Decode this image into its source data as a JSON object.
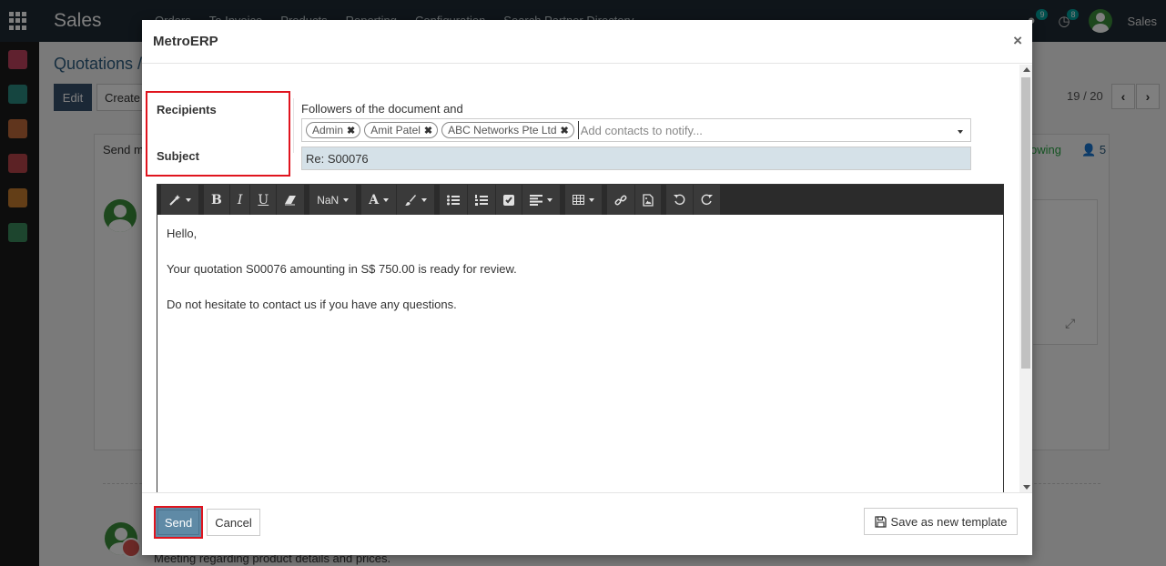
{
  "background": {
    "app_name": "Sales",
    "top_menu": [
      "Orders",
      "To Invoice",
      "Products",
      "Reporting",
      "Configuration",
      "Search Partner Directory"
    ],
    "messages_badge": "9",
    "activities_badge": "8",
    "user_name": "Sales",
    "breadcrumb": "Quotations /",
    "edit_label": "Edit",
    "create_label": "Create",
    "pager": "19 / 20",
    "send_message_partial": "Send m",
    "following_partial": "owing",
    "followers_count": "5",
    "meeting_text": "Meeting regarding product details and prices."
  },
  "modal": {
    "title": "MetroERP",
    "close_glyph": "×",
    "recipients_label": "Recipients",
    "subject_label": "Subject",
    "followers_text": "Followers of the document and",
    "recipient_tags": [
      {
        "name": "Admin"
      },
      {
        "name": "Amit Patel"
      },
      {
        "name": "ABC Networks Pte Ltd"
      }
    ],
    "tag_remove_glyph": "✖",
    "recipients_placeholder": "Add contacts to notify...",
    "subject_value": "Re: S00076",
    "toolbar": {
      "bold": "B",
      "italic": "I",
      "underline": "U",
      "font_size": "NaN",
      "font_color": "A"
    },
    "body_lines": [
      "Hello,",
      "Your quotation S00076 amounting in S$ 750.00 is ready for review.",
      "Do not hesitate to contact us if you have any questions."
    ],
    "send_label": "Send",
    "cancel_label": "Cancel",
    "save_template_label": "Save as new template"
  },
  "colors": {
    "highlight": "#e0141e",
    "send_button": "#5f8aa6",
    "subject_bg": "#d5e1e8",
    "topbar": "#1e2a35"
  }
}
